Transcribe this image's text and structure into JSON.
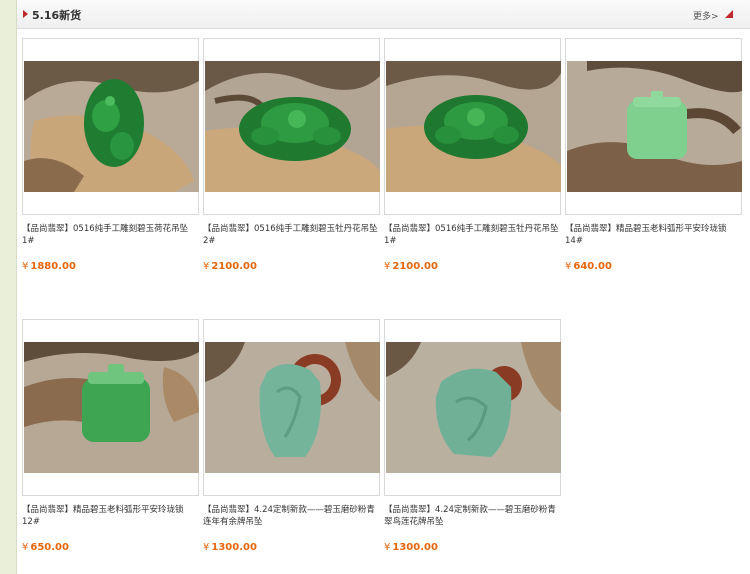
{
  "section": {
    "title": "5.16新货",
    "more_label": "更多>"
  },
  "colors": {
    "accent": "#c0262b",
    "price": "#e8660c",
    "page_bg": "#e9efd9"
  },
  "currency_symbol": "¥",
  "products": [
    {
      "name": "【品尚翡翠】0516纯手工雕刻碧玉荷花吊坠1#",
      "price": "1880.00",
      "photo": "carved-green-lotus-pendant"
    },
    {
      "name": "【品尚翡翠】0516纯手工雕刻碧玉牡丹花吊坠2#",
      "price": "2100.00",
      "photo": "carved-green-peony-pendant"
    },
    {
      "name": "【品尚翡翠】0516纯手工雕刻碧玉牡丹花吊坠1#",
      "price": "2100.00",
      "photo": "carved-green-peony-pendant"
    },
    {
      "name": "【品尚翡翠】精品碧玉老料弧形平安玲珑锁14#",
      "price": "640.00",
      "photo": "green-jade-lock-pendant"
    },
    {
      "name": "【品尚翡翠】精品碧玉老料弧形平安玲珑锁12#",
      "price": "650.00",
      "photo": "green-jade-lock-pendant"
    },
    {
      "name": "【品尚翡翠】4.24定制新款——碧玉磨砂粉青连年有余牌吊坠",
      "price": "1300.00",
      "photo": "pale-jade-plaque-pendant"
    },
    {
      "name": "【品尚翡翠】4.24定制新款——碧玉磨砂粉青翠鸟莲花牌吊坠",
      "price": "1300.00",
      "photo": "pale-jade-plaque-pendant"
    }
  ]
}
